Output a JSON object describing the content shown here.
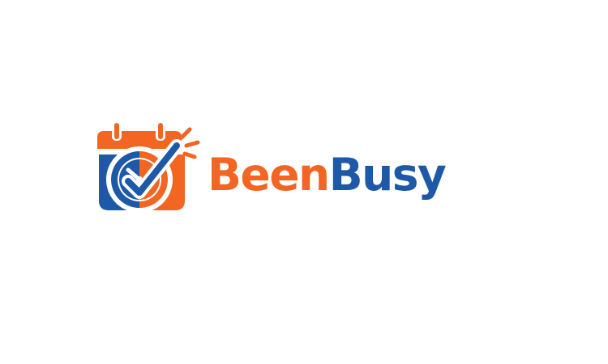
{
  "logo": {
    "wordmark_part_1": "Been",
    "wordmark_part_2": "Busy",
    "icon": "calendar-clock-check-icon"
  },
  "colors": {
    "orange": "#f26522",
    "blue": "#1d59a6",
    "background": "#ffffff"
  }
}
